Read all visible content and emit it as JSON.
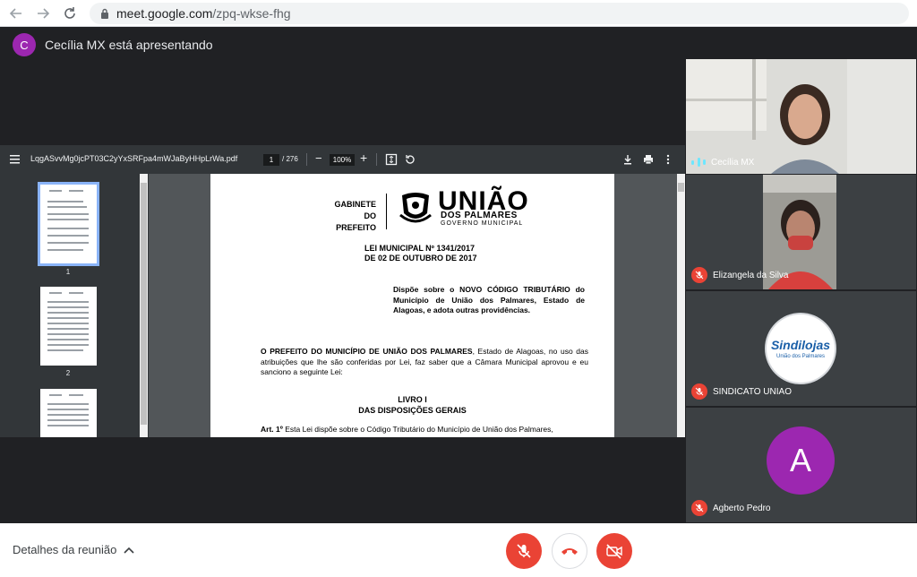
{
  "browser": {
    "url_host": "meet.google.com",
    "url_path": "/zpq-wkse-fhg"
  },
  "meet": {
    "presenter_initial": "C",
    "presenter_text": "Cecília MX está apresentando"
  },
  "pdf": {
    "filename": "LqgASvvMg0jcPT03C2yYxSRFpa4mWJaByHHpLrWa.pdf",
    "current_page": "1",
    "total_pages": "/ 276",
    "zoom": "100%",
    "thumbnails": [
      "1",
      "2"
    ],
    "doc": {
      "header_left_line1": "GABINETE",
      "header_left_line2": "DO PREFEITO",
      "logo_main": "UNIÃO",
      "logo_sub": "DOS PALMARES",
      "logo_sub2": "GOVERNO MUNICIPAL",
      "law_number": "LEI MUNICIPAL Nº 1341/2017",
      "law_date": "DE 02 DE OUTUBRO DE 2017",
      "summary": "Dispõe sobre o NOVO CÓDIGO TRIBUTÁRIO do Município de União dos Palmares, Estado de Alagoas, e adota outras providências.",
      "body_bold": "O PREFEITO DO MUNICÍPIO DE UNIÃO DOS PALMARES",
      "body_rest": ", Estado de Alagoas, no uso das atribuições que lhe são conferidas por Lei, faz saber que a Câmara Municipal aprovou e eu sanciono a seguinte Lei:",
      "book_title": "LIVRO I",
      "book_subtitle": "DAS DISPOSIÇÕES GERAIS",
      "article_label": "Art. 1º",
      "article_text": " Esta Lei dispõe sobre o Código Tributário do Município de União dos Palmares,"
    }
  },
  "participants": [
    {
      "name": "Cecília MX",
      "status": "speaking"
    },
    {
      "name": "Elizangela da Silva",
      "status": "muted"
    },
    {
      "name": "SINDICATO UNIAO",
      "status": "muted",
      "logo_text": "Sindilojas",
      "logo_sub": "União dos Palmares"
    },
    {
      "name": "Agberto Pedro",
      "status": "muted",
      "initial": "A"
    }
  ],
  "bottom": {
    "details_label": "Detalhes da reunião"
  },
  "colors": {
    "meet_bg": "#202124",
    "tile_bg": "#3c4043",
    "danger": "#ea4335",
    "avatar_purple": "#9c27b0"
  }
}
